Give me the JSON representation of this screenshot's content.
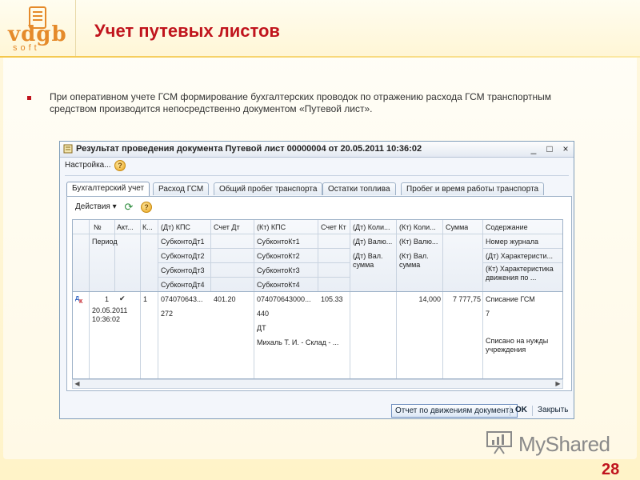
{
  "slide": {
    "title": "Учет путевых листов",
    "bullet": "При оперативном учете ГСМ формирование бухгалтерских проводок по отражению расхода ГСМ транспортным средством производится непосредственно документом «Путевой лист».",
    "page_number": "28",
    "logo_main": "vdgb",
    "logo_sub": "soft"
  },
  "window": {
    "title": "Результат проведения документа Путевой лист 00000004 от 20.05.2011 10:36:02",
    "minimize": "_",
    "maximize": "□",
    "close": "×",
    "settings_label": "Настройка...",
    "help": "?",
    "tabs": [
      {
        "label": "Бухгалтерский учет",
        "active": true
      },
      {
        "label": "Расход ГСМ",
        "active": false
      },
      {
        "label": "Общий пробег транспорта",
        "active": false
      },
      {
        "label": "Остатки топлива",
        "active": false
      },
      {
        "label": "Пробег и время работы транспорта",
        "active": false
      }
    ],
    "actions_label": "Действия ▾",
    "refresh_icon": "⟳",
    "buttons": {
      "report": "Отчет по движениям документа",
      "ok": "OK",
      "close": "Закрыть"
    }
  },
  "table": {
    "header_row1": [
      "№",
      "Акт...",
      "К...",
      "(Дт) КПС",
      "Счет Дт",
      "(Кт) КПС",
      "Счет Кт",
      "(Дт) Коли...",
      "(Кт) Коли...",
      "Сумма",
      "Содержание"
    ],
    "header_row2": [
      "Период",
      "",
      "",
      "СубконтоДт1",
      "",
      "СубконтоКт1",
      "",
      "(Дт) Валю...",
      "(Кт) Валю...",
      "",
      "Номер журнала"
    ],
    "header_row3": [
      "",
      "",
      "",
      "СубконтоДт2",
      "",
      "СубконтоКт2",
      "",
      "(Дт) Вал. сумма",
      "(Кт) Вал. сумма",
      "",
      "(Дт) Характеристи..."
    ],
    "header_row4": [
      "",
      "",
      "",
      "СубконтоДт3",
      "",
      "СубконтоКт3",
      "",
      "",
      "",
      "",
      "(Кт) Характеристика движения по ..."
    ],
    "header_row5": [
      "",
      "",
      "",
      "СубконтоДт4",
      "",
      "СубконтоКт4",
      "",
      "",
      "",
      "",
      ""
    ],
    "row": {
      "number": "1",
      "active": "✔",
      "k": "1",
      "period": "20.05.2011 10:36:02",
      "dt_kps": "074070643...",
      "schet_dt": "401.20",
      "kt_kps": "074070643000...",
      "schet_kt": "105.33",
      "kt_qty": "14,000",
      "summa": "7 777,75",
      "content": "Списание ГСМ",
      "subkonto_dt1": "272",
      "subkonto_kt1": "440",
      "journal": "7",
      "subkonto_kt2": "ДТ",
      "subkonto_kt3": "Михаль Т. И. - Склад - ...",
      "content_note": "Списано на нужды учреждения"
    }
  },
  "watermark": {
    "text": "MyShared"
  },
  "colors": {
    "title_red": "#c0141d",
    "logo_orange": "#e58a2a",
    "window_border": "#7f9db9"
  }
}
